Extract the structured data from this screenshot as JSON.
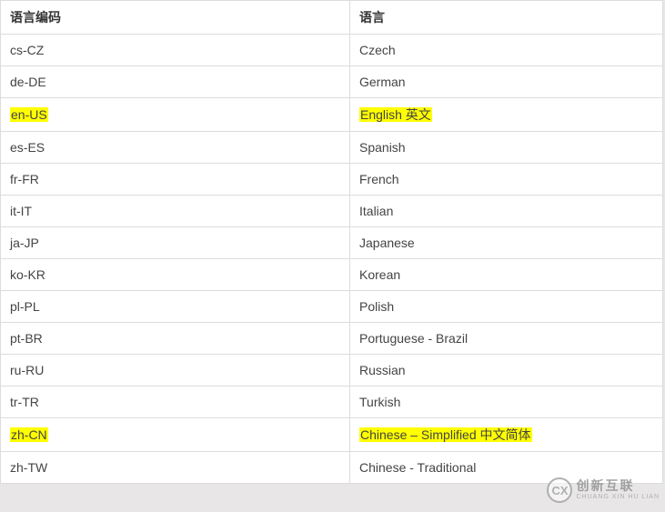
{
  "table": {
    "headers": [
      "语言编码",
      "语言"
    ],
    "rows": [
      {
        "code": "cs-CZ",
        "lang": "Czech",
        "hl": false
      },
      {
        "code": "de-DE",
        "lang": "German",
        "hl": false
      },
      {
        "code": "en-US",
        "lang": "English 英文",
        "hl": true
      },
      {
        "code": "es-ES",
        "lang": "Spanish",
        "hl": false
      },
      {
        "code": "fr-FR",
        "lang": "French",
        "hl": false
      },
      {
        "code": "it-IT",
        "lang": "Italian",
        "hl": false
      },
      {
        "code": "ja-JP",
        "lang": "Japanese",
        "hl": false
      },
      {
        "code": "ko-KR",
        "lang": "Korean",
        "hl": false
      },
      {
        "code": "pl-PL",
        "lang": "Polish",
        "hl": false
      },
      {
        "code": "pt-BR",
        "lang": "Portuguese - Brazil",
        "hl": false
      },
      {
        "code": "ru-RU",
        "lang": "Russian",
        "hl": false
      },
      {
        "code": "tr-TR",
        "lang": "Turkish",
        "hl": false
      },
      {
        "code": "zh-CN",
        "lang": "Chinese – Simplified 中文简体",
        "hl": true
      },
      {
        "code": "zh-TW",
        "lang": "Chinese - Traditional",
        "hl": false
      }
    ]
  },
  "watermark": {
    "logo": "CX",
    "cn": "创新互联",
    "en": "CHUANG XIN HU LIAN"
  }
}
